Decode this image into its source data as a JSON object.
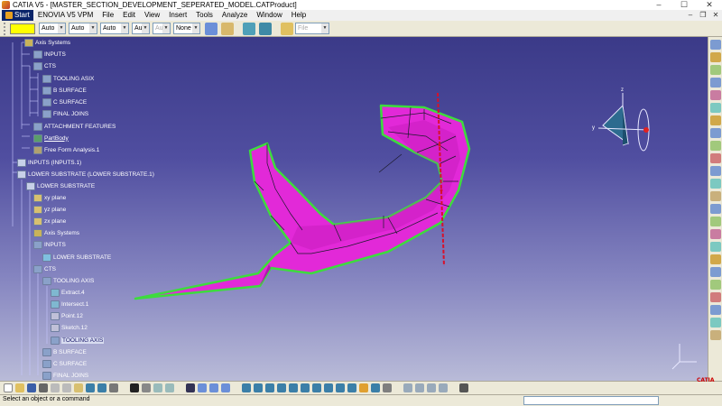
{
  "window": {
    "title": "CATIA V5 - [MASTER_SECTION_DEVELOPMENT_SEPERATED_MODEL.CATProduct]",
    "minimize_glyph": "–",
    "maximize_glyph": "☐",
    "close_glyph": "✕"
  },
  "menu": {
    "start": "Start",
    "items": [
      "ENOVIA V5 VPM",
      "File",
      "Edit",
      "View",
      "Insert",
      "Tools",
      "Analyze",
      "Window",
      "Help"
    ],
    "doc_minimize": "–",
    "doc_restore": "❐",
    "doc_close": "✕"
  },
  "properties_toolbar": {
    "color_value": "#ffff00",
    "combos": [
      {
        "value": "Auto",
        "disabled": false
      },
      {
        "value": "Auto",
        "disabled": false
      },
      {
        "value": "Auto",
        "disabled": false
      },
      {
        "value": "Aut",
        "disabled": false
      },
      {
        "value": "Aut",
        "disabled": true
      },
      {
        "value": "None",
        "disabled": false
      }
    ],
    "file_combo": "File"
  },
  "tree": {
    "nodes": [
      {
        "label": "Axis Systems",
        "icon": "axis-systems-icon"
      },
      {
        "label": "INPUTS",
        "icon": "geometrical-set-icon"
      },
      {
        "label": "CTS",
        "icon": "geometrical-set-icon"
      },
      {
        "label": "TOOLING ASIX",
        "icon": "geometrical-set-icon"
      },
      {
        "label": "B SURFACE",
        "icon": "geometrical-set-icon"
      },
      {
        "label": "C SURFACE",
        "icon": "geometrical-set-icon"
      },
      {
        "label": "FINAL JOINS",
        "icon": "geometrical-set-icon"
      },
      {
        "label": "ATTACHMENT FEATURES",
        "icon": "geometrical-set-icon"
      },
      {
        "label": "PartBody",
        "icon": "partbody-icon"
      },
      {
        "label": "Free Form Analysis.1",
        "icon": "analysis-icon"
      },
      {
        "label": "INPUTS (INPUTS.1)",
        "icon": "product-icon"
      },
      {
        "label": "LOWER SUBSTRATE (LOWER SUBSTRATE.1)",
        "icon": "product-icon"
      },
      {
        "label": "LOWER SUBSTRATE",
        "icon": "part-icon"
      },
      {
        "label": "xy plane",
        "icon": "plane-icon"
      },
      {
        "label": "yz plane",
        "icon": "plane-icon"
      },
      {
        "label": "zx plane",
        "icon": "plane-icon"
      },
      {
        "label": "Axis Systems",
        "icon": "axis-systems-icon"
      },
      {
        "label": "INPUTS",
        "icon": "geometrical-set-icon"
      },
      {
        "label": "LOWER SUBSTRATE",
        "icon": "surface-icon"
      },
      {
        "label": "CTS",
        "icon": "geometrical-set-icon"
      },
      {
        "label": "TOOLING AXIS",
        "icon": "geometrical-set-icon"
      },
      {
        "label": "Extract.4",
        "icon": "extract-icon"
      },
      {
        "label": "Intersect.1",
        "icon": "intersect-icon"
      },
      {
        "label": "Point.12",
        "icon": "point-icon"
      },
      {
        "label": "Sketch.12",
        "icon": "sketch-icon"
      },
      {
        "label": "TOOLING AXIS",
        "icon": "geometrical-set-icon"
      },
      {
        "label": "B SURFACE",
        "icon": "geometrical-set-icon"
      },
      {
        "label": "C SURFACE",
        "icon": "geometrical-set-icon"
      },
      {
        "label": "FINAL JOINS",
        "icon": "geometrical-set-icon"
      }
    ]
  },
  "status": {
    "prompt": "Select an object or a command"
  },
  "logo": "CATIA",
  "colors": {
    "surface": "#e229d8",
    "highlight_edge": "#3ddc3d",
    "axis_line": "#d8102a",
    "background_top": "#3b3a88",
    "background_bottom": "#b9bbd8"
  }
}
